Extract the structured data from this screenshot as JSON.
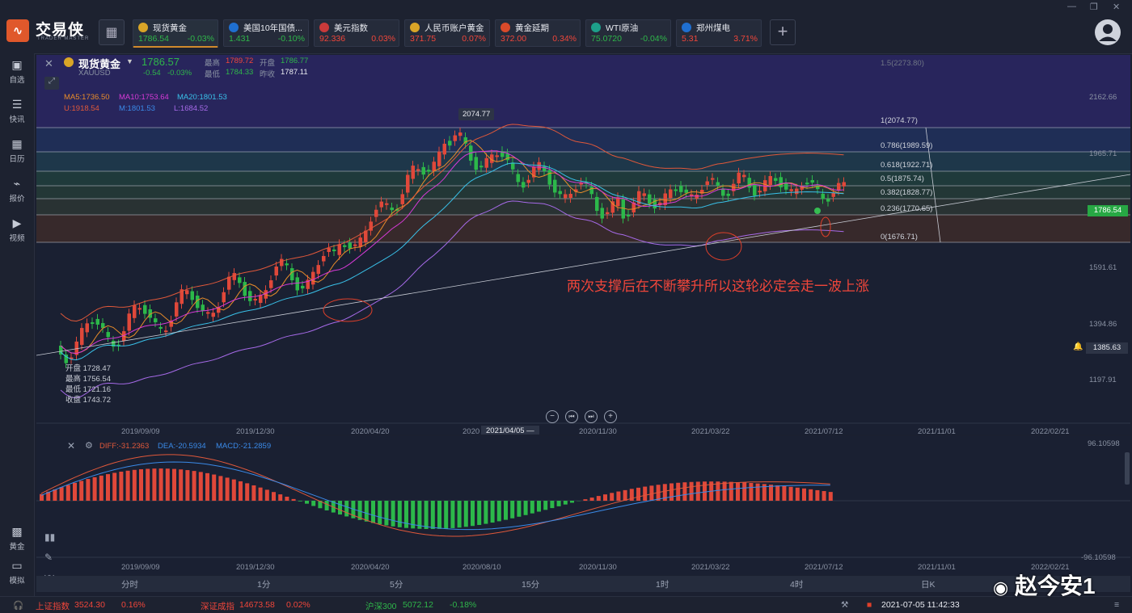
{
  "app": {
    "brand": "交易侠",
    "brand_sub": "TRADER MASTER"
  },
  "tabs": [
    {
      "name": "现货黄金",
      "price": "1786.54",
      "change": "-0.03%",
      "dir": "down",
      "active": true,
      "icon_color": "#d9a527",
      "icon": "coin-icon"
    },
    {
      "name": "美国10年国债...",
      "price": "1.431",
      "change": "-0.10%",
      "dir": "down",
      "active": false,
      "icon_color": "#1f6fd0",
      "icon": "bar-chart-icon"
    },
    {
      "name": "美元指数",
      "price": "92.336",
      "change": "0.03%",
      "dir": "up",
      "active": false,
      "icon_color": "#c93a3a",
      "icon": "us-flag-icon"
    },
    {
      "name": "人民币账户黄金",
      "price": "371.75",
      "change": "0.07%",
      "dir": "up",
      "active": false,
      "icon_color": "#d9a527",
      "icon": "coin-icon"
    },
    {
      "name": "黄金延期",
      "price": "372.00",
      "change": "0.34%",
      "dir": "up",
      "active": false,
      "icon_color": "#d94a2a",
      "icon": "gold-bar-icon"
    },
    {
      "name": "WTI原油",
      "price": "75.0720",
      "change": "-0.04%",
      "dir": "down",
      "active": false,
      "icon_color": "#1d9f8a",
      "icon": "oil-icon"
    },
    {
      "name": "郑州煤电",
      "price": "5.31",
      "change": "3.71%",
      "dir": "up",
      "active": false,
      "icon_color": "#1f6fd0",
      "icon": "bar-chart-icon"
    }
  ],
  "sidebar": [
    {
      "label": "自选",
      "icon": "bookmark-icon"
    },
    {
      "label": "快讯",
      "icon": "news-icon"
    },
    {
      "label": "日历",
      "icon": "calendar-icon"
    },
    {
      "label": "报价",
      "icon": "trend-icon"
    },
    {
      "label": "视频",
      "icon": "play-icon"
    }
  ],
  "sidebar_bottom": [
    {
      "label": "黄金",
      "icon": "grid-icon"
    },
    {
      "label": "模拟",
      "icon": "wallet-icon"
    }
  ],
  "header": {
    "symbol": "现货黄金",
    "code": "XAUUSD",
    "last": "1786.57",
    "chg": "-0.54",
    "chg_pct": "-0.03%",
    "high_label": "最高",
    "high": "1789.72",
    "open_label": "开盘",
    "open": "1786.77",
    "low_label": "最低",
    "low": "1784.33",
    "prev_label": "昨收",
    "prev": "1787.11"
  },
  "ma_line": {
    "ma5": "MA5:1736.50",
    "ma10": "MA10:1753.64",
    "ma20": "MA20:1801.53"
  },
  "boll_line": {
    "u": "U:1918.54",
    "m": "M:1801.53",
    "l": "L:1684.52"
  },
  "ohlc_box": {
    "open": "开盘 1728.47",
    "high": "最高 1756.54",
    "low": "最低 1721.16",
    "close": "收盘 1743.72"
  },
  "peak_label": "2074.77",
  "fib": [
    {
      "label": "1.5(2273.80)"
    },
    {
      "label": "1(2074.77)"
    },
    {
      "label": "0.786(1989.59)"
    },
    {
      "label": "0.618(1922.71)"
    },
    {
      "label": "0.5(1875.74)"
    },
    {
      "label": "0.382(1828.77)"
    },
    {
      "label": "0.236(1770.65)"
    },
    {
      "label": "0(1676.71)"
    }
  ],
  "price_axis": [
    "2162.66",
    "1965.71",
    "1591.61",
    "1394.86",
    "1197.91"
  ],
  "current_price_tag": "1786.54",
  "alert_price": "1385.63",
  "annotation": "两次支撑后在不断攀升所以这轮必定会走一波上涨",
  "x_axis": [
    "2019/09/09",
    "2019/12/30",
    "2020/04/20",
    "2020",
    "2020/11/30",
    "2021/03/22",
    "2021/07/12",
    "2021/11/01",
    "2022/02/21"
  ],
  "x_cursor": "2021/04/05 —",
  "macd": {
    "diff": "DIFF:-31.2363",
    "dea": "DEA:-20.5934",
    "macd": "MACD:-21.2859",
    "top": "96.10598",
    "bottom": "-96.10598"
  },
  "macd_x_axis": [
    "2019/09/09",
    "2019/12/30",
    "2020/04/20",
    "2020/08/10",
    "2020/11/30",
    "2021/03/22",
    "2021/07/12",
    "2021/11/01",
    "2022/02/21"
  ],
  "timeframes": [
    "分时",
    "1分",
    "5分",
    "15分",
    "1时",
    "4时",
    "日K"
  ],
  "status": {
    "sh_label": "上证指数",
    "sh_val": "3524.30",
    "sh_pct": "0.16%",
    "sz_label": "深证成指",
    "sz_val": "14673.58",
    "sz_pct": "0.02%",
    "hs_label": "沪深300",
    "hs_val": "5072.12",
    "hs_pct": "-0.18%",
    "datetime": "2021-07-05 11:42:33"
  },
  "watermark": "赵今安1",
  "chart_data": {
    "type": "candlestick",
    "note_series": [
      "MA5",
      "MA10",
      "MA20",
      "U",
      "M",
      "L"
    ],
    "fib_levels": [
      2273.8,
      2074.77,
      1989.59,
      1922.71,
      1875.74,
      1828.77,
      1770.65,
      1676.71
    ]
  }
}
